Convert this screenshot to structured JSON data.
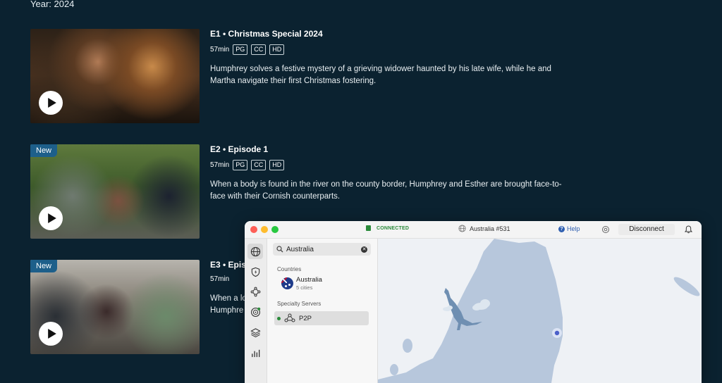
{
  "header": {
    "year": "Year: 2024"
  },
  "episodes": [
    {
      "title": "E1 • Christmas Special 2024",
      "duration": "57min",
      "tags": [
        "PG",
        "CC",
        "HD"
      ],
      "description": "Humphrey solves a festive mystery of a grieving widower haunted by his late wife, while he and Martha navigate their first Christmas fostering.",
      "badge": ""
    },
    {
      "title": "E2 • Episode 1",
      "duration": "57min",
      "tags": [
        "PG",
        "CC",
        "HD"
      ],
      "description": "When a body is found in the river on the county border, Humphrey and Esther are brought face-to-face with their Cornish counterparts.",
      "badge": "New"
    },
    {
      "title": "E3 • Episo",
      "duration": "57min",
      "tags": [],
      "description_line1": "When a lo",
      "description_line2": "Humphre",
      "badge": "New"
    }
  ],
  "vpn": {
    "status": "CONNECTED",
    "server": "Australia #531",
    "help_label": "Help",
    "disconnect_label": "Disconnect",
    "search_value": "Australia",
    "countries_label": "Countries",
    "country_name": "Australia",
    "country_sub": "5 cities",
    "specialty_label": "Specialty Servers",
    "specialty_item": "P2P",
    "colors": {
      "connected": "#2a8a3a",
      "help": "#2f5fb0",
      "land": "#b7c7dc",
      "water": "#eef1f5"
    },
    "rail_icons": [
      "globe-icon",
      "shield-bolt-icon",
      "mesh-network-icon",
      "target-icon",
      "layers-icon",
      "stats-icon"
    ]
  }
}
